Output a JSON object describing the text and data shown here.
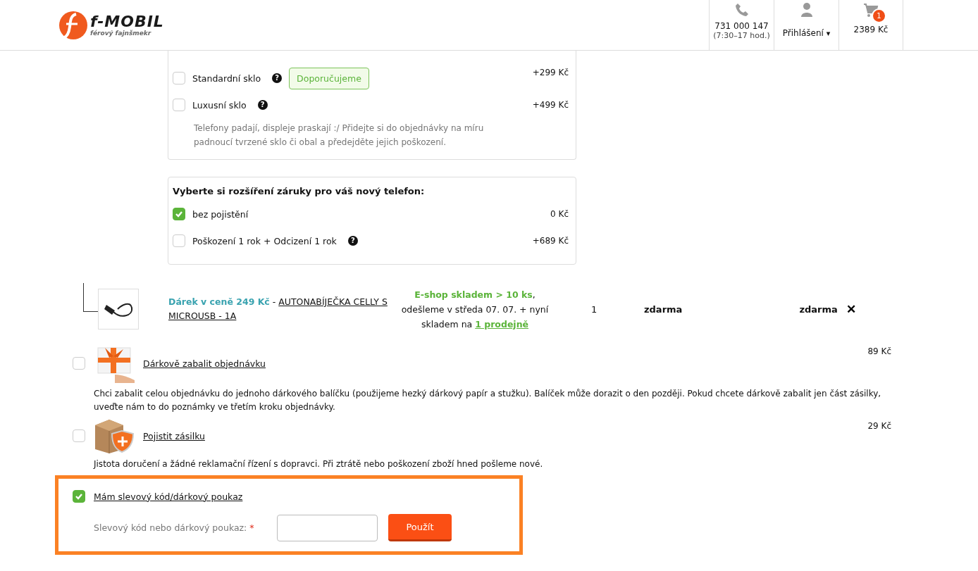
{
  "header": {
    "logo": {
      "name": "f-MOBIL",
      "tagline": "férový fajnšmekr"
    },
    "phone": {
      "number": "731 000 147",
      "hours": "(7:30–17 hod.)"
    },
    "login": {
      "label": "Přihlášení",
      "caret": "▾"
    },
    "cart": {
      "count": "1",
      "total": "2389 Kč"
    }
  },
  "glass_card": {
    "options": [
      {
        "label": "Standardní sklo",
        "help": "?",
        "badge": "Doporučujeme",
        "price": "+299 Kč",
        "checked": false
      },
      {
        "label": "Luxusní sklo",
        "help": "?",
        "price": "+499 Kč",
        "checked": false
      }
    ],
    "note": "Telefony padají, displeje praskají :/ Přidejte si do objednávky na míru padnoucí tvrzené sklo či obal a předejděte jejich poškození."
  },
  "warranty_card": {
    "title": "Vyberte si rozšíření záruky pro váš nový telefon:",
    "options": [
      {
        "label": "bez pojistění",
        "price": "0 Kč",
        "checked": true
      },
      {
        "label": "Poškození 1 rok + Odcizení 1 rok",
        "help": "?",
        "price": "+689 Kč",
        "checked": false
      }
    ]
  },
  "gift_item": {
    "gift_label": "Dárek v ceně 249 Kč",
    "separator": " - ",
    "product": "AUTONABÍJEČKA CELLY S MICROUSB - 1A",
    "stock": {
      "status": "E-shop skladem > 10 ks",
      "after_status": ",",
      "shipping": "odešleme v středa 07. 07. + nyní skladem na",
      "stores_link": "1 prodejně"
    },
    "quantity": "1",
    "unit_price": "zdarma",
    "total_price": "zdarma",
    "remove": "✕"
  },
  "extras": [
    {
      "kind": "gift-wrap",
      "label": "Dárkově zabalit objednávku",
      "price": "89 Kč",
      "checked": false,
      "description": "Chci zabalit celou objednávku do jednoho dárkového balíčku (použijeme hezký dárkový papír a stužku). Balíček může dorazit o den později. Pokud chcete dárkově zabalit jen část zásilky, uveďte nám to do poznámky ve třetím kroku objednávky."
    },
    {
      "kind": "insurance",
      "label": "Pojistit zásilku",
      "price": "29 Kč",
      "checked": false,
      "description": "Jistota doručení a žádné reklamační řízení s dopravci. Při ztrátě nebo poškození zboží hned pošleme nové."
    }
  ],
  "coupon": {
    "label": "Mám slevový kód/dárkový poukaz",
    "checked": true,
    "field_label": "Slevový kód nebo dárkový poukaz:",
    "required_mark": "*",
    "button": "Použít"
  }
}
